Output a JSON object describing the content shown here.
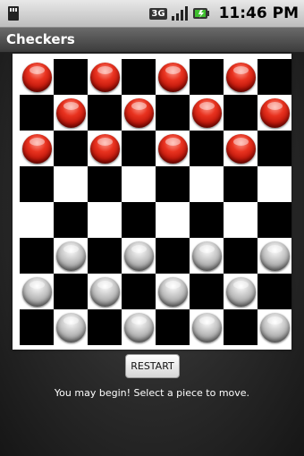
{
  "status_bar": {
    "network_label": "3G",
    "time": "11:46 PM"
  },
  "app": {
    "title": "Checkers"
  },
  "board": {
    "light_color": "#ffffff",
    "dark_color": "#000000",
    "red_color": "#d92a18",
    "gray_color": "#b5b5b5",
    "layout": [
      "r.r.r.r.",
      ".r.r.r.r",
      "r.r.r.r.",
      "........",
      "........",
      ".g.g.g.g",
      "g.g.g.g.",
      ".g.g.g.g"
    ]
  },
  "controls": {
    "restart_label": "RESTART"
  },
  "message": "You may begin! Select a piece to move."
}
